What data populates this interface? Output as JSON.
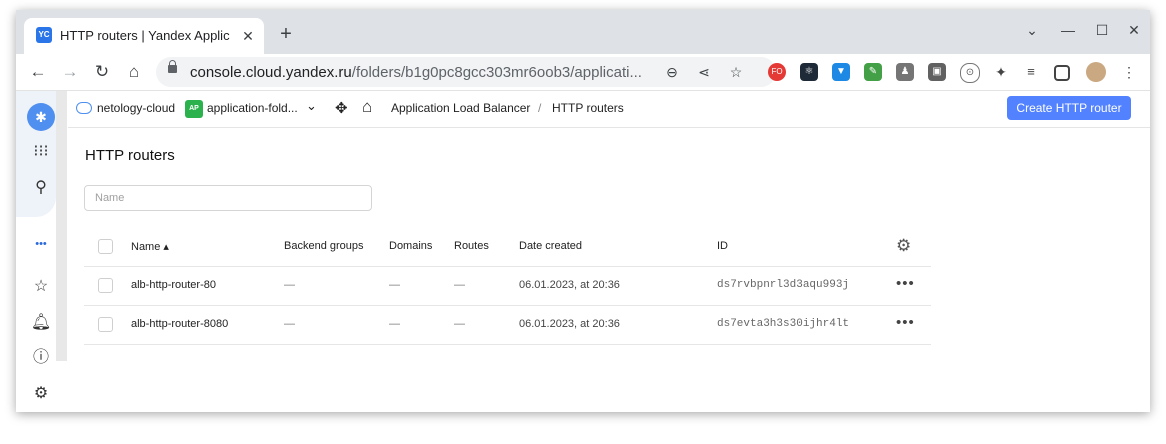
{
  "browser": {
    "tab_title": "HTTP routers | Yandex Applic",
    "tab_favicon_text": "YC",
    "tab_close": "✕",
    "new_tab": "+",
    "url_host": "console.cloud.yandex.ru",
    "url_path": "/folders/b1g0pc8gcc303mr6oob3/applicati...",
    "extension_fo_label": "FO",
    "colors": {
      "tab_bar": "#dee1e6",
      "favicon": "#2a76e8"
    }
  },
  "left_nav": {
    "icons": [
      "yc-brand-icon",
      "apps-grid-icon",
      "search-icon",
      "more-dots-icon",
      "star-icon",
      "bell-icon",
      "help-icon",
      "settings-icon"
    ],
    "more_label": "•••"
  },
  "breadcrumb": {
    "cloud": "netology-cloud",
    "folder_badge": "AP",
    "folder": "application-fold...",
    "service": "Application Load Balancer",
    "separator": "/",
    "current": "HTTP routers"
  },
  "header": {
    "create_button": "Create HTTP router",
    "colors": {
      "accent": "#5282ff"
    }
  },
  "page": {
    "title": "HTTP routers",
    "search_placeholder": "Name"
  },
  "table": {
    "columns": [
      "Name ▴",
      "Backend groups",
      "Domains",
      "Routes",
      "Date created",
      "ID"
    ],
    "rows": [
      {
        "name": "alb-http-router-80",
        "backend_groups": "—",
        "domains": "—",
        "routes": "—",
        "date_created": "06.01.2023, at 20:36",
        "id": "ds7rvbpnrl3d3aqu993j"
      },
      {
        "name": "alb-http-router-8080",
        "backend_groups": "—",
        "domains": "—",
        "routes": "—",
        "date_created": "06.01.2023, at 20:36",
        "id": "ds7evta3h3s30ijhr4lt"
      }
    ],
    "row_menu": "•••"
  }
}
